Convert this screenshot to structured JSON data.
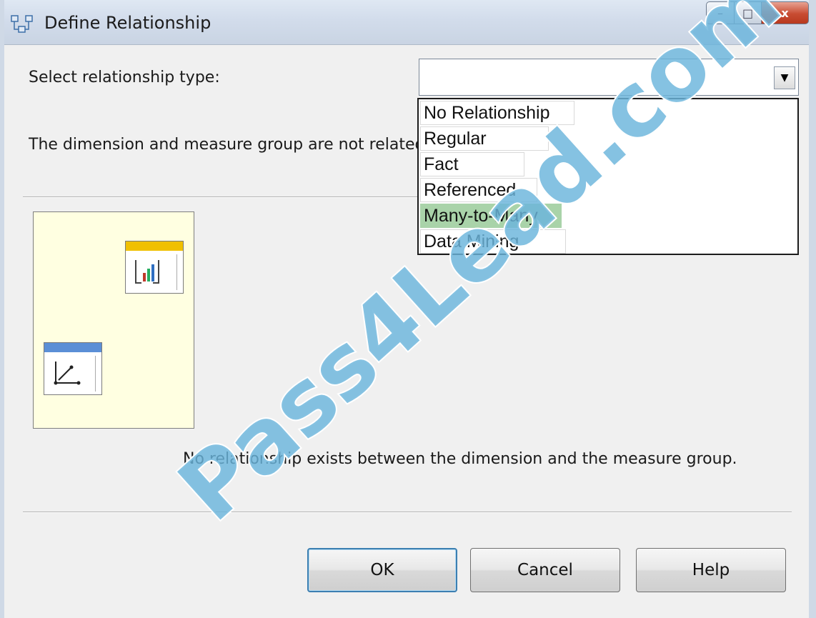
{
  "window": {
    "title": "Define Relationship",
    "minimize_glyph": "–",
    "maximize_glyph": "□",
    "close_glyph": "x"
  },
  "form": {
    "select_label": "Select relationship type:",
    "combo_value": "",
    "dropdown_arrow": "▼",
    "options": [
      {
        "label": "No Relationship",
        "selected": false
      },
      {
        "label": "Regular",
        "selected": false
      },
      {
        "label": "Fact",
        "selected": false
      },
      {
        "label": "Referenced",
        "selected": false
      },
      {
        "label": "Many-to-Many",
        "selected": true
      },
      {
        "label": "Data Mining",
        "selected": false
      }
    ],
    "status_text": "The dimension and measure group are not related."
  },
  "diagram": {
    "description": "No relationship exists between the dimension and the measure group.",
    "measure_group_icon": "bar-chart-table-icon",
    "dimension_icon": "axis-table-icon",
    "colors": {
      "background": "#ffffe1",
      "measure_header": "#f0c000",
      "dimension_header": "#5b8fd6"
    }
  },
  "buttons": {
    "ok": "OK",
    "cancel": "Cancel",
    "help": "Help"
  },
  "watermark": {
    "text": "Pass4Lead.com",
    "color": "#6ab4dc"
  }
}
